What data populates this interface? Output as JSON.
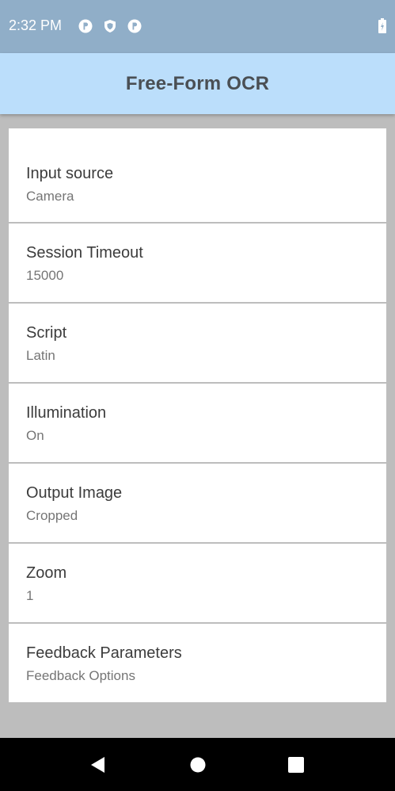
{
  "status_bar": {
    "time": "2:32 PM",
    "icons": [
      "notification-p-icon",
      "shield-icon",
      "notification-p-icon"
    ],
    "battery": "battery-charging-icon"
  },
  "app_bar": {
    "title": "Free-Form OCR"
  },
  "preferences": [
    {
      "title": "Input source",
      "summary": "Camera"
    },
    {
      "title": "Session Timeout",
      "summary": "15000"
    },
    {
      "title": "Script",
      "summary": "Latin"
    },
    {
      "title": "Illumination",
      "summary": "On"
    },
    {
      "title": "Output Image",
      "summary": "Cropped"
    },
    {
      "title": "Zoom",
      "summary": "1"
    },
    {
      "title": "Feedback Parameters",
      "summary": "Feedback Options"
    }
  ],
  "nav_bar": {
    "buttons": [
      "back-icon",
      "home-icon",
      "recents-icon"
    ]
  },
  "colors": {
    "status_bar": "#90aec8",
    "app_bar": "#bbdefb",
    "background": "#bdbdbd",
    "nav_bar": "#000000"
  }
}
